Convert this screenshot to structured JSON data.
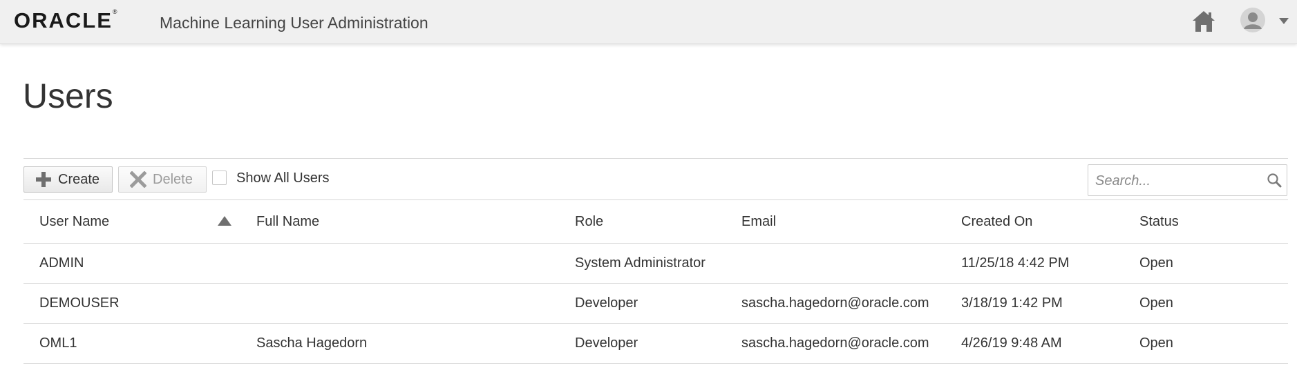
{
  "header": {
    "logo": "ORACLE",
    "logo_mark": "®",
    "app_title": "Machine Learning User Administration",
    "icons": [
      "home-icon",
      "user-avatar-icon",
      "chevron-down-icon"
    ]
  },
  "page": {
    "title": "Users"
  },
  "toolbar": {
    "create_label": "Create",
    "delete_label": "Delete",
    "show_all_label": "Show All Users",
    "show_all_checked": false,
    "search_placeholder": "Search...",
    "search_value": ""
  },
  "table": {
    "columns": [
      "User Name",
      "Full Name",
      "Role",
      "Email",
      "Created On",
      "Status"
    ],
    "sort": {
      "column": "User Name",
      "direction": "ascending"
    },
    "rows": [
      {
        "user_name": "ADMIN",
        "full_name": "",
        "role": "System Administrator",
        "email": "",
        "created_on": "11/25/18 4:42 PM",
        "status": "Open"
      },
      {
        "user_name": "DEMOUSER",
        "full_name": "",
        "role": "Developer",
        "email": "sascha.hagedorn@oracle.com",
        "created_on": "3/18/19 1:42 PM",
        "status": "Open"
      },
      {
        "user_name": "OML1",
        "full_name": "Sascha Hagedorn",
        "role": "Developer",
        "email": "sascha.hagedorn@oracle.com",
        "created_on": "4/26/19 9:48 AM",
        "status": "Open"
      }
    ]
  },
  "colors": {
    "link": "#2a6db0",
    "topbar": "#f0f0f0",
    "icon_gray": "#6f6f6f"
  }
}
